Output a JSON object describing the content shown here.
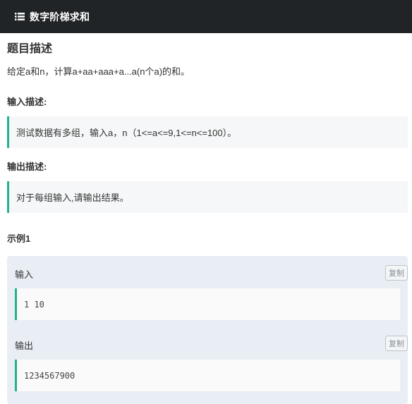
{
  "header": {
    "icon": "list-icon",
    "title": "数字阶梯求和"
  },
  "problem": {
    "heading": "题目描述",
    "description": "给定a和n，计算a+aa+aaa+a...a(n个a)的和。",
    "input_heading": "输入描述:",
    "input_text": "测试数据有多组，输入a，n（1<=a<=9,1<=n<=100）。",
    "output_heading": "输出描述:",
    "output_text": "对于每组输入,请输出结果。"
  },
  "example": {
    "heading": "示例1",
    "input_label": "输入",
    "input_value": "1 10",
    "output_label": "输出",
    "output_value": "1234567900",
    "copy_label": "复制"
  },
  "colors": {
    "header_bg": "#202427",
    "accent": "#25b08f",
    "example_bg": "#e9eef5"
  }
}
